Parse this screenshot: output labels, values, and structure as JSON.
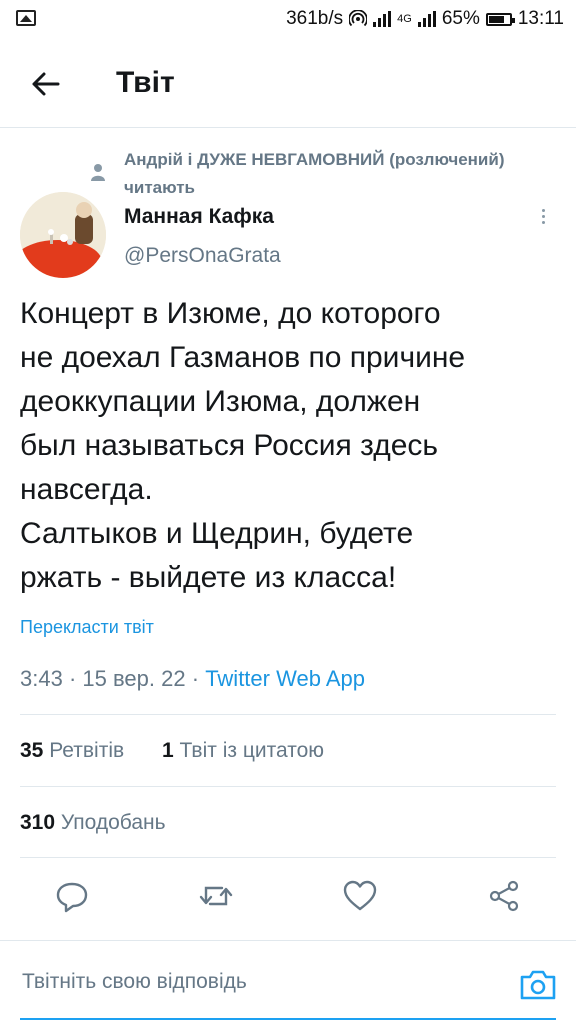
{
  "status_bar": {
    "speed": "361b/s",
    "network": "4G",
    "battery": "65%",
    "time": "13:11"
  },
  "header": {
    "title": "Твіт"
  },
  "context": {
    "text": "Андрій і ДУЖЕ НЕВГАМОВНИЙ (розлючений) читають"
  },
  "author": {
    "name": "Манная Кафка",
    "handle": "@PersOnaGrata"
  },
  "tweet": {
    "text": "Концерт в Изюме, до которого\nне доехал Газманов по причине\nдеоккупации Изюма, должен\nбыл называться Россия здесь\nнавсегда.\nСалтыков и Щедрин, будете\nржать - выйдете из класса!",
    "translate_label": "Перекласти твіт",
    "time": "3:43",
    "date": "15 вер. 22",
    "source": "Twitter Web App"
  },
  "stats": {
    "retweets_count": "35",
    "retweets_label": "Ретвітів",
    "quotes_count": "1",
    "quotes_label": "Твіт із цитатою",
    "likes_count": "310",
    "likes_label": "Уподобань"
  },
  "reply": {
    "placeholder": "Твітніть свою відповідь"
  },
  "icons": {
    "back": "arrow-left-icon",
    "person": "person-icon",
    "more": "more-vertical-icon",
    "reply": "reply-icon",
    "retweet": "retweet-icon",
    "like": "heart-icon",
    "share": "share-icon",
    "camera": "camera-icon"
  },
  "colors": {
    "accent": "#1da1f2",
    "muted": "#657786",
    "link": "#1b95e0"
  }
}
